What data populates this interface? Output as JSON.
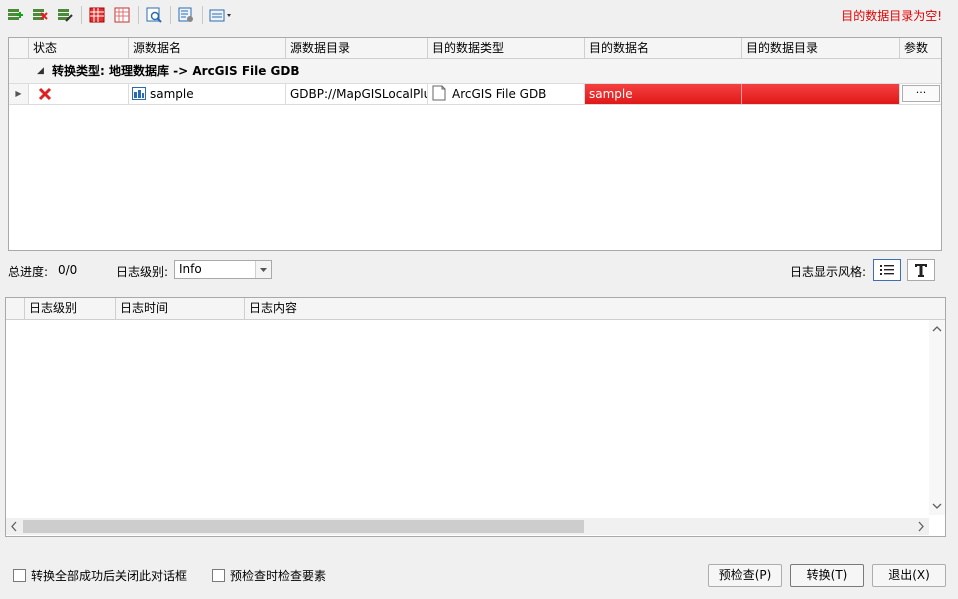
{
  "toolbar": {
    "items": [
      {
        "icon": "add-icon"
      },
      {
        "icon": "delete-icon"
      },
      {
        "icon": "edit-icon"
      },
      {
        "icon": "select-all-icon"
      },
      {
        "icon": "deselect-all-icon"
      },
      {
        "icon": "preview-icon"
      },
      {
        "icon": "settings-icon"
      },
      {
        "icon": "export-dropdown-icon"
      }
    ],
    "status_message": "目的数据目录为空!"
  },
  "task_grid": {
    "columns": [
      "状态",
      "源数据名",
      "源数据目录",
      "目的数据类型",
      "目的数据名",
      "目的数据目录",
      "参数"
    ],
    "group_label": "转换类型: 地理数据库 -> ArcGIS File GDB",
    "rows": [
      {
        "status_icon": "error-x-icon",
        "source_name": "sample",
        "source_dir": "GDBP://MapGISLocalPlus",
        "dest_type": "ArcGIS File GDB",
        "dest_name": "sample",
        "dest_dir": "",
        "params": "···"
      }
    ],
    "error_color": "#ee1c1c"
  },
  "progress": {
    "label": "总进度:",
    "value": "0/0",
    "log_level_label": "日志级别:",
    "log_level_value": "Info",
    "log_style_label": "日志显示风格:"
  },
  "log_grid": {
    "columns": [
      "日志级别",
      "日志时间",
      "日志内容"
    ]
  },
  "footer": {
    "checkbox_close": "转换全部成功后关闭此对话框",
    "checkbox_precheck": "预检查时检查要素",
    "precheck_button": "预检查(P)",
    "convert_button": "转换(T)",
    "exit_button": "退出(X)"
  }
}
